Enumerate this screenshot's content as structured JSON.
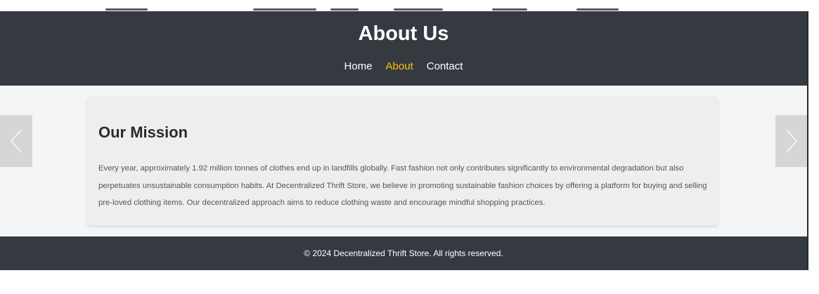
{
  "header": {
    "title": "About Us",
    "nav": [
      {
        "label": "Home",
        "active": false
      },
      {
        "label": "About",
        "active": true
      },
      {
        "label": "Contact",
        "active": false
      }
    ]
  },
  "mission": {
    "heading": "Our Mission",
    "body": "Every year, approximately 1.92 million tonnes of clothes end up in landfills globally. Fast fashion not only contributes significantly to environmental degradation but also perpetuates unsustainable consumption habits. At Decentralized Thrift Store, we believe in promoting sustainable fashion choices by offering a platform for buying and selling pre-loved clothing items. Our decentralized approach aims to reduce clothing waste and encourage mindful shopping practices."
  },
  "carousel": {
    "prev_icon": "chevron-left-icon",
    "next_icon": "chevron-right-icon"
  },
  "footer": {
    "text": "© 2024 Decentralized Thrift Store. All rights reserved."
  },
  "colors": {
    "header_bg": "#343a40",
    "active_link": "#ffc107",
    "main_bg": "#f4f5f7",
    "card_bg": "#eeeeee",
    "arrow_bg": "#d6d6d6"
  }
}
